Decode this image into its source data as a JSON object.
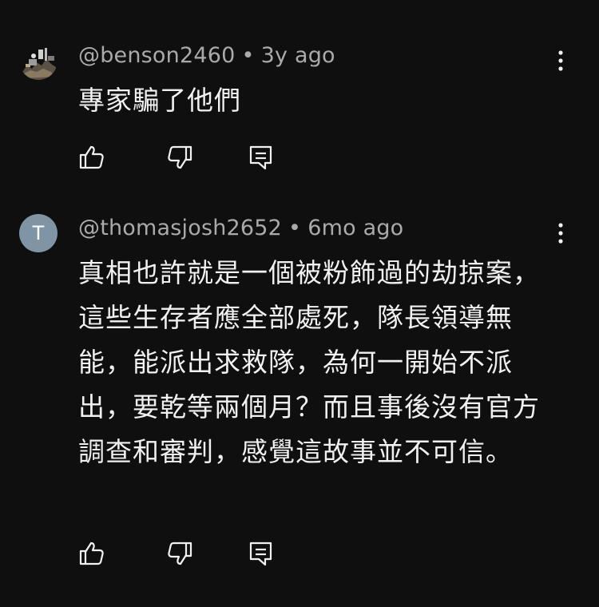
{
  "comments": [
    {
      "handle": "@benson2460",
      "separator": "•",
      "time": "3y ago",
      "text": "專家騙了他們",
      "avatar_letter": ""
    },
    {
      "handle": "@thomasjosh2652",
      "separator": "•",
      "time": "6mo ago",
      "text": "真相也許就是一個被粉飾過的劫掠案，這些生存者應全部處死，隊長領導無能，能派出求救隊，為何一開始不派出，要乾等兩個月？而且事後沒有官方調查和審判，感覺這故事並不可信。",
      "avatar_letter": "T"
    }
  ],
  "icons": {
    "like": "thumbs-up-icon",
    "dislike": "thumbs-down-icon",
    "reply": "reply-icon",
    "more": "more-vertical-icon"
  },
  "colors": {
    "background": "#0f0f0f",
    "text": "#f1f1f1",
    "meta": "#aaaaaa",
    "avatar_bg": "#7f95a6"
  }
}
